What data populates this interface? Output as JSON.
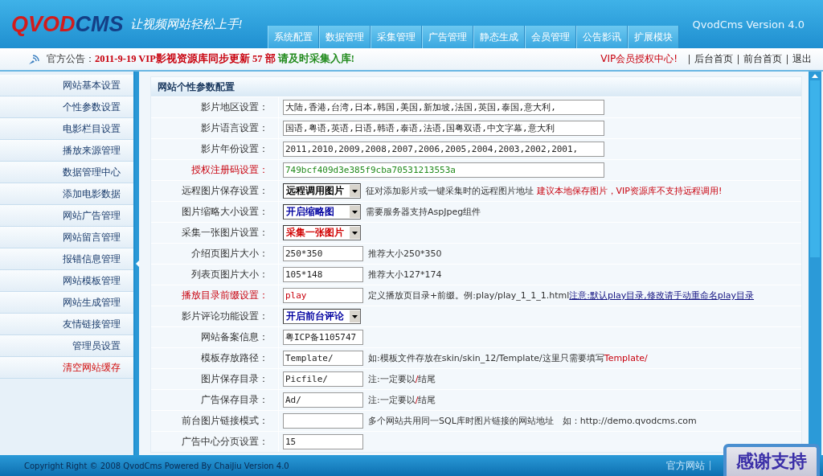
{
  "header": {
    "logo": [
      {
        "text": "QVOD",
        "color": "#d31b1b"
      },
      {
        "text": "CMS",
        "color": "#143f86"
      }
    ],
    "slogan": "让视频网站轻松上手!",
    "version": "QvodCms Version 4.0",
    "nav": [
      {
        "label": "系统配置"
      },
      {
        "label": "数据管理"
      },
      {
        "label": "采集管理"
      },
      {
        "label": "广告管理"
      },
      {
        "label": "静态生成"
      },
      {
        "label": "会员管理"
      },
      {
        "label": "公告影讯"
      },
      {
        "label": "扩展模块"
      }
    ]
  },
  "notice": {
    "label": "官方公告：",
    "parts": [
      {
        "text": "2011-9-19 VIP影视资源库同步更新 57 部 ",
        "color": "#c8000d"
      },
      {
        "text": "请及时采集入库!",
        "color": "#218a1c"
      }
    ]
  },
  "top_links": [
    {
      "label": "VIP会员授权中心!",
      "kind": "vip"
    },
    {
      "label": "后台首页",
      "kind": "plain"
    },
    {
      "label": "前台首页",
      "kind": "plain"
    },
    {
      "label": "退出",
      "kind": "plain"
    }
  ],
  "sidebar": {
    "items": [
      {
        "label": "网站基本设置",
        "kind": "normal"
      },
      {
        "label": "个性参数设置",
        "kind": "normal"
      },
      {
        "label": "电影栏目设置",
        "kind": "normal"
      },
      {
        "label": "播放来源管理",
        "kind": "normal"
      },
      {
        "label": "数据管理中心",
        "kind": "normal"
      },
      {
        "label": "添加电影数据",
        "kind": "normal"
      },
      {
        "label": "网站广告管理",
        "kind": "normal"
      },
      {
        "label": "网站留言管理",
        "kind": "normal"
      },
      {
        "label": "报错信息管理",
        "kind": "normal"
      },
      {
        "label": "网站模板管理",
        "kind": "normal"
      },
      {
        "label": "网站生成管理",
        "kind": "normal"
      },
      {
        "label": "友情链接管理",
        "kind": "normal"
      },
      {
        "label": "管理员设置",
        "kind": "normal"
      },
      {
        "label": "清空网站缓存",
        "kind": "warning"
      }
    ]
  },
  "panel": {
    "title": "网站个性参数配置",
    "rows": [
      {
        "label": "影片地区设置：",
        "emphasis": false,
        "kind": "text",
        "wide": true,
        "value": "大陆,香港,台湾,日本,韩国,美国,新加坡,法国,英国,泰国,意大利,",
        "color": "#222222"
      },
      {
        "label": "影片语言设置：",
        "emphasis": false,
        "kind": "text",
        "wide": true,
        "value": "国语,粤语,英语,日语,韩语,泰语,法语,国粤双语,中文字幕,意大利",
        "color": "#222222"
      },
      {
        "label": "影片年份设置：",
        "emphasis": false,
        "kind": "text",
        "wide": true,
        "value": "2011,2010,2009,2008,2007,2006,2005,2004,2003,2002,2001,",
        "color": "#222222"
      },
      {
        "label": "授权注册码设置：",
        "emphasis": true,
        "kind": "text",
        "wide": true,
        "value": "749bcf409d3e385f9cba70531213553a",
        "color": "#218a1c"
      },
      {
        "label": "远程图片保存设置：",
        "emphasis": false,
        "kind": "select",
        "value": "远程调用图片",
        "color": "#000000",
        "hint": "征对添加影片或一键采集时的远程图片地址 **建议本地保存图片，VIP资源库不支持远程调用!**"
      },
      {
        "label": "图片缩略大小设置：",
        "emphasis": false,
        "kind": "select",
        "value": "开启缩略图",
        "color": "#0000a0",
        "hint": "需要服务器支持AspJpeg组件"
      },
      {
        "label": "采集一张图片设置：",
        "emphasis": false,
        "kind": "select",
        "value": "采集一张图片",
        "color": "#d00000"
      },
      {
        "label": "介绍页图片大小：",
        "emphasis": false,
        "kind": "text",
        "wide": false,
        "value": "250*350",
        "color": "#222222",
        "hint": "推荐大小250*350"
      },
      {
        "label": "列表页图片大小：",
        "emphasis": false,
        "kind": "text",
        "wide": false,
        "value": "105*148",
        "color": "#222222",
        "hint": "推荐大小127*174"
      },
      {
        "label": "播放目录前缀设置：",
        "emphasis": true,
        "kind": "text",
        "wide": false,
        "value": "play",
        "color": "#c8000d",
        "hint": "定义播放页目录+前缀。例:play/play_1_1_1.html",
        "link": "注意:默认play目录,修改请手动重命名play目录"
      },
      {
        "label": "影片评论功能设置：",
        "emphasis": false,
        "kind": "select",
        "value": "开启前台评论",
        "color": "#0000a0"
      },
      {
        "label": "网站备案信息：",
        "emphasis": false,
        "kind": "text",
        "wide": false,
        "value": "粤ICP备1105747",
        "color": "#222222"
      },
      {
        "label": "模板存放路径：",
        "emphasis": false,
        "kind": "text",
        "wide": false,
        "value": "Template/",
        "color": "#222222",
        "hint": "如:模板文件存放在skin/skin_12/Template/这里只需要填写**Template/**"
      },
      {
        "label": "图片保存目录：",
        "emphasis": false,
        "kind": "text",
        "wide": false,
        "value": "Picfile/",
        "color": "#222222",
        "hint": "注:一定要以**/**结尾"
      },
      {
        "label": "广告保存目录：",
        "emphasis": false,
        "kind": "text",
        "wide": false,
        "value": "Ad/",
        "color": "#222222",
        "hint": "注:一定要以**/**结尾"
      },
      {
        "label": "前台图片链接模式：",
        "emphasis": false,
        "kind": "text",
        "wide": false,
        "value": "",
        "hint": "多个网站共用同一SQL库时图片链接的网站地址　如：http://demo.qvodcms.com"
      },
      {
        "label": "广告中心分页设置：",
        "emphasis": false,
        "kind": "text",
        "wide": false,
        "value": "15",
        "color": "#222222"
      }
    ]
  },
  "footer": {
    "copyright": "Copyright Right © 2008 QvodCms Powered By ChaiJiu Version 4.0",
    "links": [
      {
        "label": "官方网站"
      }
    ]
  },
  "badge": {
    "label": "感谢支持"
  }
}
